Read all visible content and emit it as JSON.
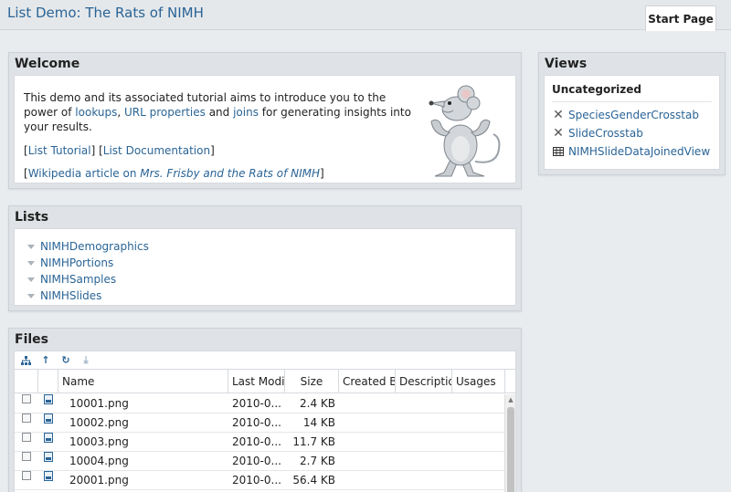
{
  "header": {
    "title": "List Demo: The Rats of NIMH",
    "tab": "Start Page"
  },
  "welcome": {
    "title": "Welcome",
    "intro_1": "This demo and its associated tutorial aims to introduce you to the power of ",
    "link_lookups": "lookups",
    "sep_1": ", ",
    "link_url_properties": "URL properties",
    "and_1": " and ",
    "link_joins": "joins",
    "intro_2": " for generating insights into your results.",
    "bracket_open": "[",
    "bracket_mid": "] [",
    "bracket_close": "]",
    "link_list_tutorial": "List Tutorial",
    "link_list_documentation": "List Documentation",
    "wiki_prefix": "Wikipedia article on ",
    "wiki_italic": "Mrs. Frisby and the Rats of NIMH"
  },
  "lists": {
    "title": "Lists",
    "items": [
      {
        "label": "NIMHDemographics"
      },
      {
        "label": "NIMHPortions"
      },
      {
        "label": "NIMHSamples"
      },
      {
        "label": "NIMHSlides"
      }
    ]
  },
  "views": {
    "title": "Views",
    "category": "Uncategorized",
    "items": [
      {
        "label": "SpeciesGenderCrosstab",
        "icon": "crosstab-icon"
      },
      {
        "label": "SlideCrosstab",
        "icon": "crosstab-icon"
      },
      {
        "label": "NIMHSlideDataJoinedView",
        "icon": "grid-icon"
      }
    ]
  },
  "files": {
    "title": "Files",
    "columns": {
      "name": "Name",
      "modified": "Last Modi",
      "size": "Size",
      "created_by": "Created By",
      "description": "Descriptio",
      "usages": "Usages"
    },
    "rows": [
      {
        "name": "10001.png",
        "modified": "2010-0...",
        "size": "2.4 KB"
      },
      {
        "name": "10002.png",
        "modified": "2010-0...",
        "size": "14 KB"
      },
      {
        "name": "10003.png",
        "modified": "2010-0...",
        "size": "11.7 KB"
      },
      {
        "name": "10004.png",
        "modified": "2010-0...",
        "size": "2.7 KB"
      },
      {
        "name": "20001.png",
        "modified": "2010-0...",
        "size": "56.4 KB"
      }
    ]
  }
}
